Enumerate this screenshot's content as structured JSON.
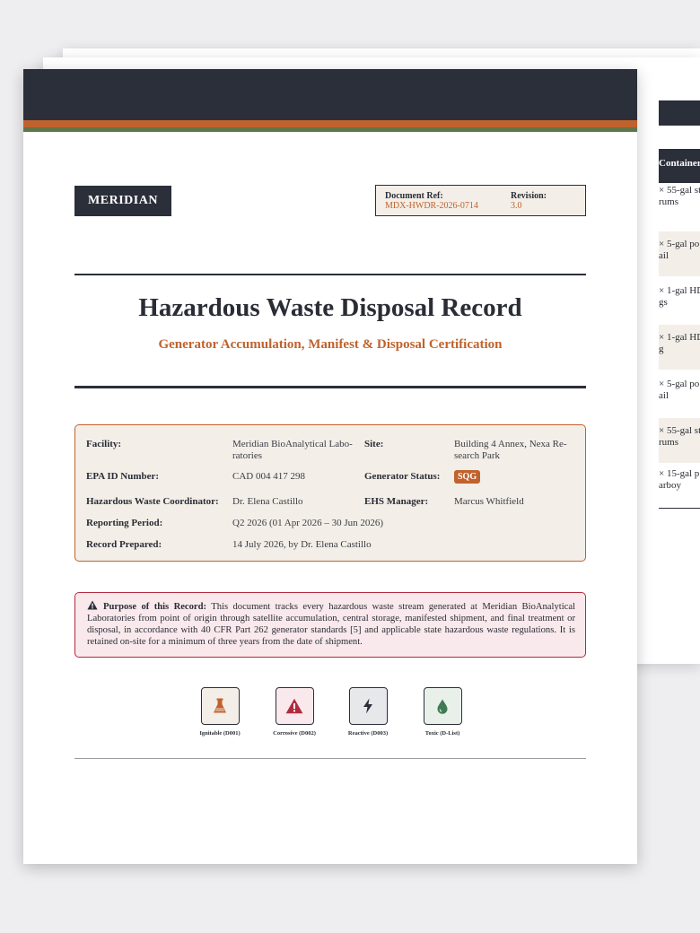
{
  "back_page": {
    "table_header": "Container(s)",
    "rows": [
      {
        "line1": "× 55-gal st",
        "line2": "rums"
      },
      {
        "line1": "× 5-gal po",
        "line2": "ail"
      },
      {
        "line1": "× 1-gal HD",
        "line2": "gs"
      },
      {
        "line1": "× 1-gal HD",
        "line2": "g"
      },
      {
        "line1": "× 5-gal po",
        "line2": "ail"
      },
      {
        "line1": "× 55-gal st",
        "line2": "rums"
      },
      {
        "line1": "× 15-gal p",
        "line2": "arboy"
      }
    ]
  },
  "brand": {
    "logo_text": "MERIDIAN"
  },
  "doc_ref": {
    "ref_label": "Document Ref:",
    "ref_value": "MDX-HWDR-2026-0714",
    "revision_label": "Revision:",
    "revision_value": "3.0"
  },
  "title": "Hazardous Waste Disposal Record",
  "subtitle": "Generator Accumulation, Manifest & Disposal Certification",
  "facility": {
    "facility_label": "Facility:",
    "facility_value_line1": "Meridian BioAnalytical Labo-",
    "facility_value_line2": "ratories",
    "site_label": "Site:",
    "site_value_line1": "Building 4 Annex, Nexa Re-",
    "site_value_line2": "search Park",
    "epa_label": "EPA ID Number:",
    "epa_value": "CAD 004 417 298",
    "status_label": "Generator Status:",
    "status_value": "SQG",
    "coordinator_label": "Hazardous Waste Coordinator:",
    "coordinator_value": "Dr. Elena Castillo",
    "ehs_label": "EHS Manager:",
    "ehs_value": "Marcus Whitfield",
    "period_label": "Reporting Period:",
    "period_value": "Q2 2026 (01 Apr 2026 – 30 Jun 2026)",
    "prepared_label": "Record Prepared:",
    "prepared_value": "14 July 2026, by Dr. Elena Castillo"
  },
  "purpose": {
    "heading": "Purpose of this Record:",
    "body": "This document tracks every hazardous waste stream generated at Meridian BioAnalytical Laboratories from point of origin through satellite accumulation, central storage, manifested shipment, and final treatment or disposal, in accordance with 40 CFR Part 262 generator standards [5] and applicable state hazardous waste regulations. It is retained on-site for a minimum of three years from the date of shipment."
  },
  "hazard_icons": [
    {
      "label": "Ignitable (D001)",
      "icon": "flask-icon",
      "color": "#c0622d",
      "bg": "#f3eee7"
    },
    {
      "label": "Corrosive (D002)",
      "icon": "warning-icon",
      "color": "#b22a3e",
      "bg": "#f9e9ec"
    },
    {
      "label": "Reactive (D003)",
      "icon": "bolt-icon",
      "color": "#2b2f3a",
      "bg": "#e7e8ea"
    },
    {
      "label": "Toxic (D-List)",
      "icon": "droplet-icon",
      "color": "#3f7a52",
      "bg": "#e9f0ea"
    }
  ],
  "colors": {
    "navy": "#2b2f3a",
    "accent_orange": "#c0622d",
    "accent_green": "#5e7548",
    "alert_red": "#b22a3e",
    "panel_beige": "#f3eee7"
  }
}
